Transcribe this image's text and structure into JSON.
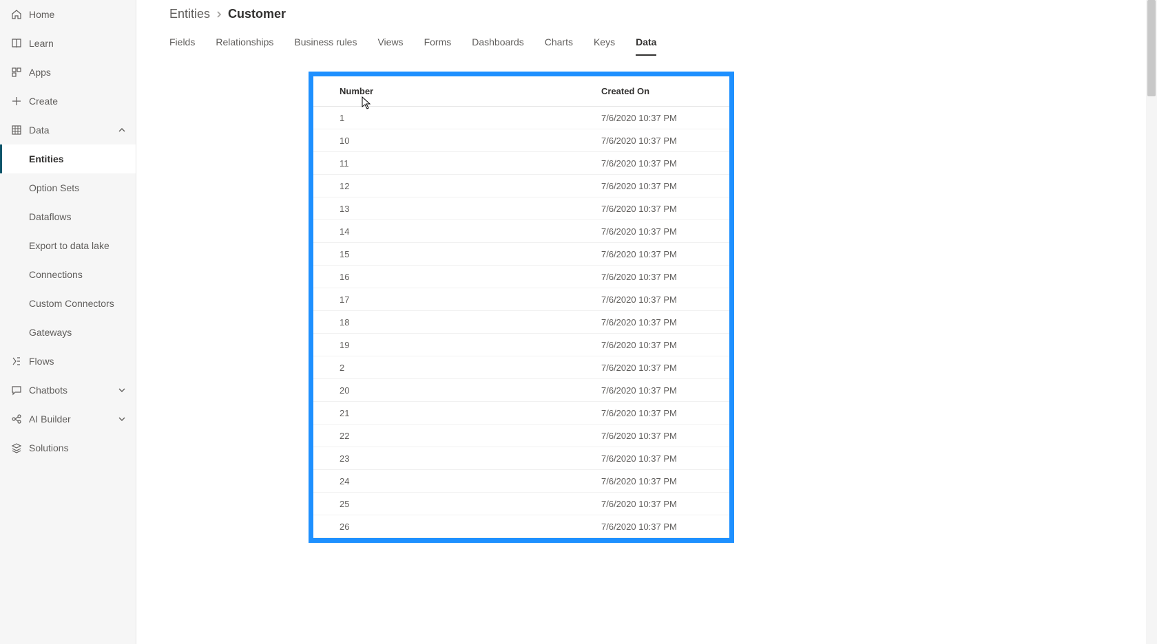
{
  "sidebar": {
    "items": [
      {
        "label": "Home",
        "icon": "home",
        "expandable": false
      },
      {
        "label": "Learn",
        "icon": "book",
        "expandable": false
      },
      {
        "label": "Apps",
        "icon": "apps",
        "expandable": false
      },
      {
        "label": "Create",
        "icon": "plus",
        "expandable": false
      },
      {
        "label": "Data",
        "icon": "grid",
        "expandable": true,
        "expanded": true,
        "children": [
          {
            "label": "Entities",
            "selected": true
          },
          {
            "label": "Option Sets"
          },
          {
            "label": "Dataflows"
          },
          {
            "label": "Export to data lake"
          },
          {
            "label": "Connections"
          },
          {
            "label": "Custom Connectors"
          },
          {
            "label": "Gateways"
          }
        ]
      },
      {
        "label": "Flows",
        "icon": "flows",
        "expandable": false
      },
      {
        "label": "Chatbots",
        "icon": "chat",
        "expandable": true,
        "expanded": false
      },
      {
        "label": "AI Builder",
        "icon": "ai",
        "expandable": true,
        "expanded": false
      },
      {
        "label": "Solutions",
        "icon": "layers",
        "expandable": false
      }
    ]
  },
  "breadcrumb": {
    "parent": "Entities",
    "current": "Customer"
  },
  "tabs": [
    {
      "label": "Fields"
    },
    {
      "label": "Relationships"
    },
    {
      "label": "Business rules"
    },
    {
      "label": "Views"
    },
    {
      "label": "Forms"
    },
    {
      "label": "Dashboards"
    },
    {
      "label": "Charts"
    },
    {
      "label": "Keys"
    },
    {
      "label": "Data",
      "active": true
    }
  ],
  "table": {
    "columns": [
      "Number",
      "Created On"
    ],
    "rows": [
      {
        "number": "1",
        "created": "7/6/2020 10:37 PM"
      },
      {
        "number": "10",
        "created": "7/6/2020 10:37 PM"
      },
      {
        "number": "11",
        "created": "7/6/2020 10:37 PM"
      },
      {
        "number": "12",
        "created": "7/6/2020 10:37 PM"
      },
      {
        "number": "13",
        "created": "7/6/2020 10:37 PM"
      },
      {
        "number": "14",
        "created": "7/6/2020 10:37 PM"
      },
      {
        "number": "15",
        "created": "7/6/2020 10:37 PM"
      },
      {
        "number": "16",
        "created": "7/6/2020 10:37 PM"
      },
      {
        "number": "17",
        "created": "7/6/2020 10:37 PM"
      },
      {
        "number": "18",
        "created": "7/6/2020 10:37 PM"
      },
      {
        "number": "19",
        "created": "7/6/2020 10:37 PM"
      },
      {
        "number": "2",
        "created": "7/6/2020 10:37 PM"
      },
      {
        "number": "20",
        "created": "7/6/2020 10:37 PM"
      },
      {
        "number": "21",
        "created": "7/6/2020 10:37 PM"
      },
      {
        "number": "22",
        "created": "7/6/2020 10:37 PM"
      },
      {
        "number": "23",
        "created": "7/6/2020 10:37 PM"
      },
      {
        "number": "24",
        "created": "7/6/2020 10:37 PM"
      },
      {
        "number": "25",
        "created": "7/6/2020 10:37 PM"
      },
      {
        "number": "26",
        "created": "7/6/2020 10:37 PM"
      }
    ]
  }
}
